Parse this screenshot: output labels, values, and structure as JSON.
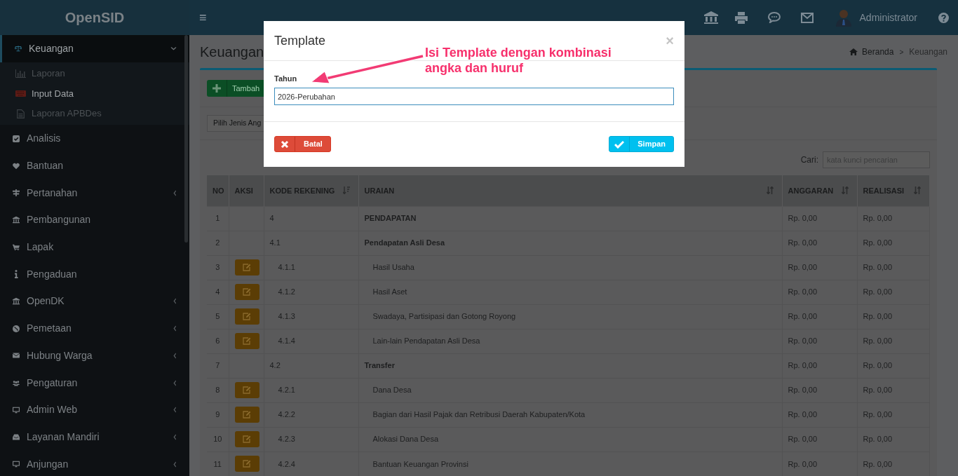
{
  "app": {
    "logo": "OpenSID",
    "menu_toggle": "≡",
    "user": "Administrator"
  },
  "sidebar": {
    "items": [
      {
        "label": "Keuangan",
        "kind": "group",
        "expanded": true,
        "selected": true,
        "children": [
          {
            "label": "Laporan",
            "selected": false
          },
          {
            "label": "Input Data",
            "selected": true
          },
          {
            "label": "Laporan APBDes",
            "selected": false
          }
        ]
      },
      {
        "label": "Analisis",
        "kind": "link",
        "selected": false
      },
      {
        "label": "Bantuan",
        "kind": "link",
        "selected": false
      },
      {
        "label": "Pertanahan",
        "kind": "group",
        "expanded": false,
        "selected": false
      },
      {
        "label": "Pembangunan",
        "kind": "link",
        "selected": false
      },
      {
        "label": "Lapak",
        "kind": "link",
        "selected": false
      },
      {
        "label": "Pengaduan",
        "kind": "link",
        "selected": false
      },
      {
        "label": "OpenDK",
        "kind": "group",
        "expanded": false,
        "selected": false
      },
      {
        "label": "Pemetaan",
        "kind": "group",
        "expanded": false,
        "selected": false
      },
      {
        "label": "Hubung Warga",
        "kind": "group",
        "expanded": false,
        "selected": false
      },
      {
        "label": "Pengaturan",
        "kind": "group",
        "expanded": false,
        "selected": false
      },
      {
        "label": "Admin Web",
        "kind": "group",
        "expanded": false,
        "selected": false
      },
      {
        "label": "Layanan Mandiri",
        "kind": "group",
        "expanded": false,
        "selected": false
      },
      {
        "label": "Anjungan",
        "kind": "group",
        "expanded": false,
        "selected": false
      }
    ]
  },
  "page": {
    "title": "Keuangan",
    "breadcrumb": [
      "Beranda",
      "Keuangan"
    ],
    "breadcrumb_separator": ">"
  },
  "toolbar": {
    "add_button": "Tambah",
    "filter_select": "Pilih Jenis Ang",
    "search_label": "Cari:",
    "search_placeholder": "kata kunci pencarian"
  },
  "table": {
    "columns": [
      "NO",
      "AKSI",
      "KODE REKENING",
      "URAIAN",
      "ANGGARAN",
      "REALISASI"
    ],
    "rows": [
      {
        "kind": "group",
        "no": "1",
        "code": "4",
        "description": "PENDAPATAN",
        "budget": "Rp. 0,00",
        "realization": "Rp. 0,00"
      },
      {
        "kind": "group",
        "no": "2",
        "code": "4.1",
        "description": "Pendapatan Asli Desa",
        "budget": "Rp. 0,00",
        "realization": "Rp. 0,00"
      },
      {
        "kind": "item",
        "no": "3",
        "code": "4.1.1",
        "description": "Hasil Usaha",
        "budget": "Rp. 0,00",
        "realization": "Rp. 0,00"
      },
      {
        "kind": "item",
        "no": "4",
        "code": "4.1.2",
        "description": "Hasil Aset",
        "budget": "Rp. 0,00",
        "realization": "Rp. 0,00"
      },
      {
        "kind": "item",
        "no": "5",
        "code": "4.1.3",
        "description": "Swadaya, Partisipasi dan Gotong Royong",
        "budget": "Rp. 0,00",
        "realization": "Rp. 0,00"
      },
      {
        "kind": "item",
        "no": "6",
        "code": "4.1.4",
        "description": "Lain-lain Pendapatan Asli Desa",
        "budget": "Rp. 0,00",
        "realization": "Rp. 0,00"
      },
      {
        "kind": "group",
        "no": "7",
        "code": "4.2",
        "description": "Transfer",
        "budget": "Rp. 0,00",
        "realization": "Rp. 0,00"
      },
      {
        "kind": "item",
        "no": "8",
        "code": "4.2.1",
        "description": "Dana Desa",
        "budget": "Rp. 0,00",
        "realization": "Rp. 0,00"
      },
      {
        "kind": "item",
        "no": "9",
        "code": "4.2.2",
        "description": "Bagian dari Hasil Pajak dan Retribusi Daerah Kabupaten/Kota",
        "budget": "Rp. 0,00",
        "realization": "Rp. 0,00"
      },
      {
        "kind": "item",
        "no": "10",
        "code": "4.2.3",
        "description": "Alokasi Dana Desa",
        "budget": "Rp. 0,00",
        "realization": "Rp. 0,00"
      },
      {
        "kind": "item",
        "no": "11",
        "code": "4.2.4",
        "description": "Bantuan Keuangan Provinsi",
        "budget": "Rp. 0,00",
        "realization": "Rp. 0,00"
      }
    ]
  },
  "modal": {
    "title": "Template",
    "close": "×",
    "field_label": "Tahun",
    "field_value": "2026-Perubahan",
    "cancel_button": "Batal",
    "save_button": "Simpan"
  },
  "annotation": {
    "text": "Isi Template dengan kombinasi angka dan huruf"
  }
}
